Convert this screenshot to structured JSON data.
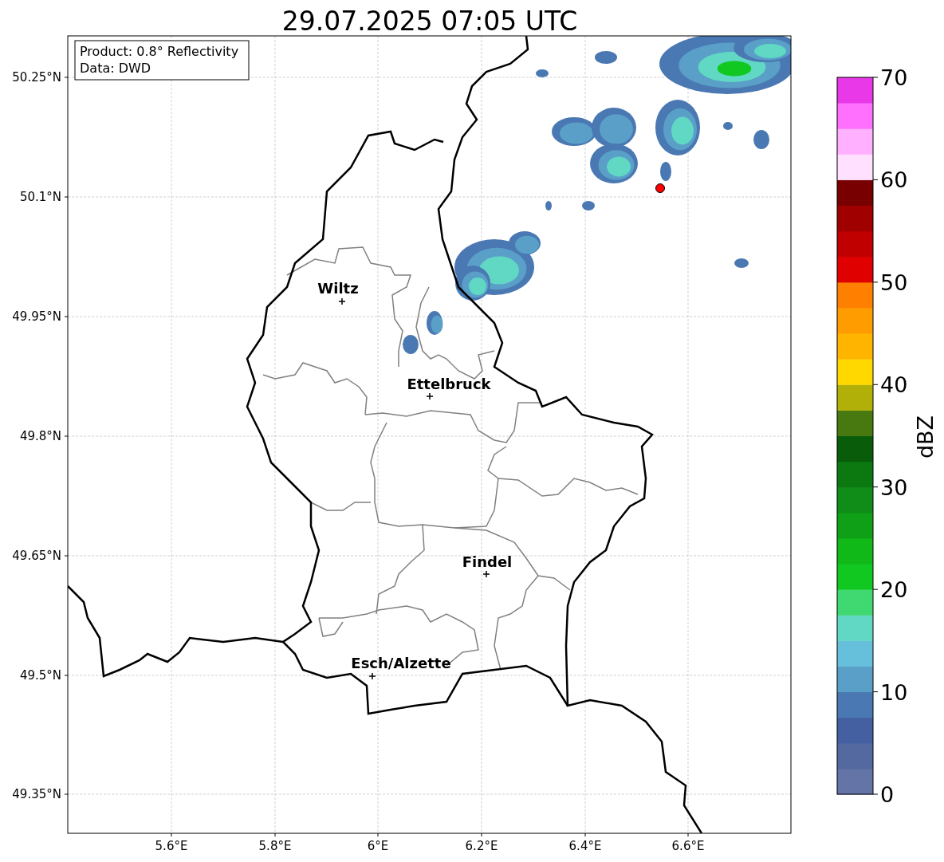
{
  "title": "29.07.2025 07:05 UTC",
  "info_box": {
    "lines": [
      "Product: 0.8° Reflectivity",
      "Data: DWD"
    ]
  },
  "lat_ticks": [
    "50.25°N",
    "50.1°N",
    "49.95°N",
    "49.8°N",
    "49.65°N",
    "49.5°N",
    "49.35°N"
  ],
  "lon_ticks": [
    "5.6°E",
    "5.8°E",
    "6°E",
    "6.2°E",
    "6.4°E",
    "6.6°E"
  ],
  "cities": [
    {
      "name": "Wiltz"
    },
    {
      "name": "Ettelbruck"
    },
    {
      "name": "Findel"
    },
    {
      "name": "Esch/Alzette"
    }
  ],
  "colorbar": {
    "label": "dBZ",
    "ticks": [
      "70",
      "60",
      "50",
      "40",
      "30",
      "20",
      "10",
      "0"
    ],
    "bins": [
      {
        "color": "#6474a6"
      },
      {
        "color": "#5369a0"
      },
      {
        "color": "#4560a0"
      },
      {
        "color": "#4a78b2"
      },
      {
        "color": "#5a9fc8"
      },
      {
        "color": "#66c0dc"
      },
      {
        "color": "#60d8c4"
      },
      {
        "color": "#40d870"
      },
      {
        "color": "#10c820"
      },
      {
        "color": "#10b818"
      },
      {
        "color": "#10a018"
      },
      {
        "color": "#108c18"
      },
      {
        "color": "#0c7810"
      },
      {
        "color": "#085c0a"
      },
      {
        "color": "#487810"
      },
      {
        "color": "#b0b008"
      },
      {
        "color": "#ffd800"
      },
      {
        "color": "#ffb400"
      },
      {
        "color": "#ff9c00"
      },
      {
        "color": "#ff8000"
      },
      {
        "color": "#e00000"
      },
      {
        "color": "#c00000"
      },
      {
        "color": "#a00000"
      },
      {
        "color": "#780000"
      },
      {
        "color": "#ffe0ff"
      },
      {
        "color": "#ffb0ff"
      },
      {
        "color": "#ff70ff"
      },
      {
        "color": "#e838e8"
      }
    ]
  }
}
